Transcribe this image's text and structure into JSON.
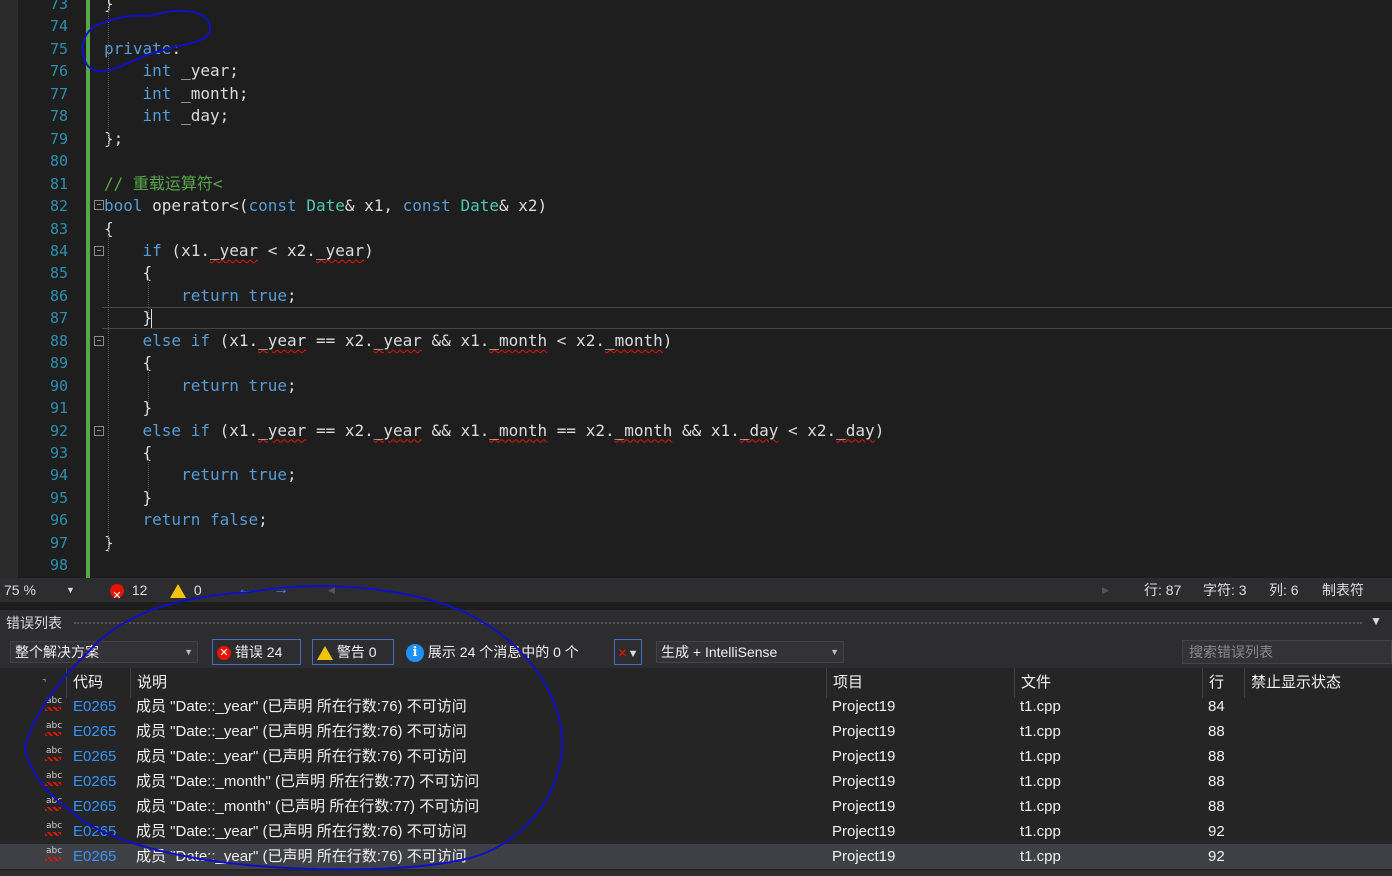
{
  "editor": {
    "lines": [
      {
        "n": "73",
        "html": "}"
      },
      {
        "n": "74",
        "html": ""
      },
      {
        "n": "75",
        "html": "<span class='kw'>private</span>:"
      },
      {
        "n": "76",
        "html": "    <span class='kw'>int</span> _year;"
      },
      {
        "n": "77",
        "html": "    <span class='kw'>int</span> _month;"
      },
      {
        "n": "78",
        "html": "    <span class='kw'>int</span> _day;"
      },
      {
        "n": "79",
        "html": "};"
      },
      {
        "n": "80",
        "html": ""
      },
      {
        "n": "81",
        "html": "<span class='cm'>// 重载运算符&lt;</span>"
      },
      {
        "n": "82",
        "html": "<span class='kw'>bool</span> operator&lt;(<span class='kw'>const</span> <span class='ty'>Date</span>&amp; x1, <span class='kw'>const</span> <span class='ty'>Date</span>&amp; x2)"
      },
      {
        "n": "83",
        "html": "{"
      },
      {
        "n": "84",
        "html": "    <span class='kw'>if</span> (x1.<span class='sq'>_year</span> &lt; x2.<span class='sq'>_year</span>)"
      },
      {
        "n": "85",
        "html": "    {"
      },
      {
        "n": "86",
        "html": "        <span class='kw'>return</span> <span class='kw'>true</span>;"
      },
      {
        "n": "87",
        "html": "    }"
      },
      {
        "n": "88",
        "html": "    <span class='kw'>else</span> <span class='kw'>if</span> (x1.<span class='sq'>_year</span> == x2.<span class='sq'>_year</span> &amp;&amp; x1.<span class='sq'>_month</span> &lt; x2.<span class='sq'>_month</span>)"
      },
      {
        "n": "89",
        "html": "    {"
      },
      {
        "n": "90",
        "html": "        <span class='kw'>return</span> <span class='kw'>true</span>;"
      },
      {
        "n": "91",
        "html": "    }"
      },
      {
        "n": "92",
        "html": "    <span class='kw'>else</span> <span class='kw'>if</span> (x1.<span class='sq'>_year</span> == x2.<span class='sq'>_year</span> &amp;&amp; x1.<span class='sq'>_month</span> == x2.<span class='sq'>_month</span> &amp;&amp; x1.<span class='sq'>_day</span> &lt; x2.<span class='sq'>_day</span>)"
      },
      {
        "n": "93",
        "html": "    {"
      },
      {
        "n": "94",
        "html": "        <span class='kw'>return</span> <span class='kw'>true</span>;"
      },
      {
        "n": "95",
        "html": "    }"
      },
      {
        "n": "96",
        "html": "    <span class='kw'>return</span> <span class='kw'>false</span>;"
      },
      {
        "n": "97",
        "html": "}"
      },
      {
        "n": "98",
        "html": ""
      }
    ]
  },
  "status": {
    "zoom": "75 %",
    "error_count": "12",
    "warning_count": "0",
    "nav_back": "←",
    "nav_forward": "→",
    "line": "行: 87",
    "char": "字符: 3",
    "col": "列: 6",
    "tab_mode": "制表符"
  },
  "error_list": {
    "title": "错误列表",
    "scope": "整个解决方案",
    "errors_label": "错误 24",
    "warnings_label": "警告 0",
    "messages_label": "展示 24 个消息中的 0 个",
    "build_filter": "生成 + IntelliSense",
    "search_placeholder": "搜索错误列表",
    "columns": {
      "code": "代码",
      "description": "说明",
      "project": "项目",
      "file": "文件",
      "line": "行",
      "suppression": "禁止显示状态"
    },
    "rows": [
      {
        "code": "E0265",
        "description": "成员 \"Date::_year\" (已声明 所在行数:76) 不可访问",
        "project": "Project19",
        "file": "t1.cpp",
        "line": "84"
      },
      {
        "code": "E0265",
        "description": "成员 \"Date::_year\" (已声明 所在行数:76) 不可访问",
        "project": "Project19",
        "file": "t1.cpp",
        "line": "88"
      },
      {
        "code": "E0265",
        "description": "成员 \"Date::_year\" (已声明 所在行数:76) 不可访问",
        "project": "Project19",
        "file": "t1.cpp",
        "line": "88"
      },
      {
        "code": "E0265",
        "description": "成员 \"Date::_month\" (已声明 所在行数:77) 不可访问",
        "project": "Project19",
        "file": "t1.cpp",
        "line": "88"
      },
      {
        "code": "E0265",
        "description": "成员 \"Date::_month\" (已声明 所在行数:77) 不可访问",
        "project": "Project19",
        "file": "t1.cpp",
        "line": "88"
      },
      {
        "code": "E0265",
        "description": "成员 \"Date::_year\" (已声明 所在行数:76) 不可访问",
        "project": "Project19",
        "file": "t1.cpp",
        "line": "92"
      },
      {
        "code": "E0265",
        "description": "成员 \"Date::_year\" (已声明 所在行数:76) 不可访问",
        "project": "Project19",
        "file": "t1.cpp",
        "line": "92"
      }
    ]
  },
  "colors": {
    "keyword": "#569cd6",
    "type": "#4ec9b0",
    "comment": "#57a64a",
    "line_number": "#2b91af",
    "error": "#e51400",
    "annotation_ink": "#1010c8"
  }
}
